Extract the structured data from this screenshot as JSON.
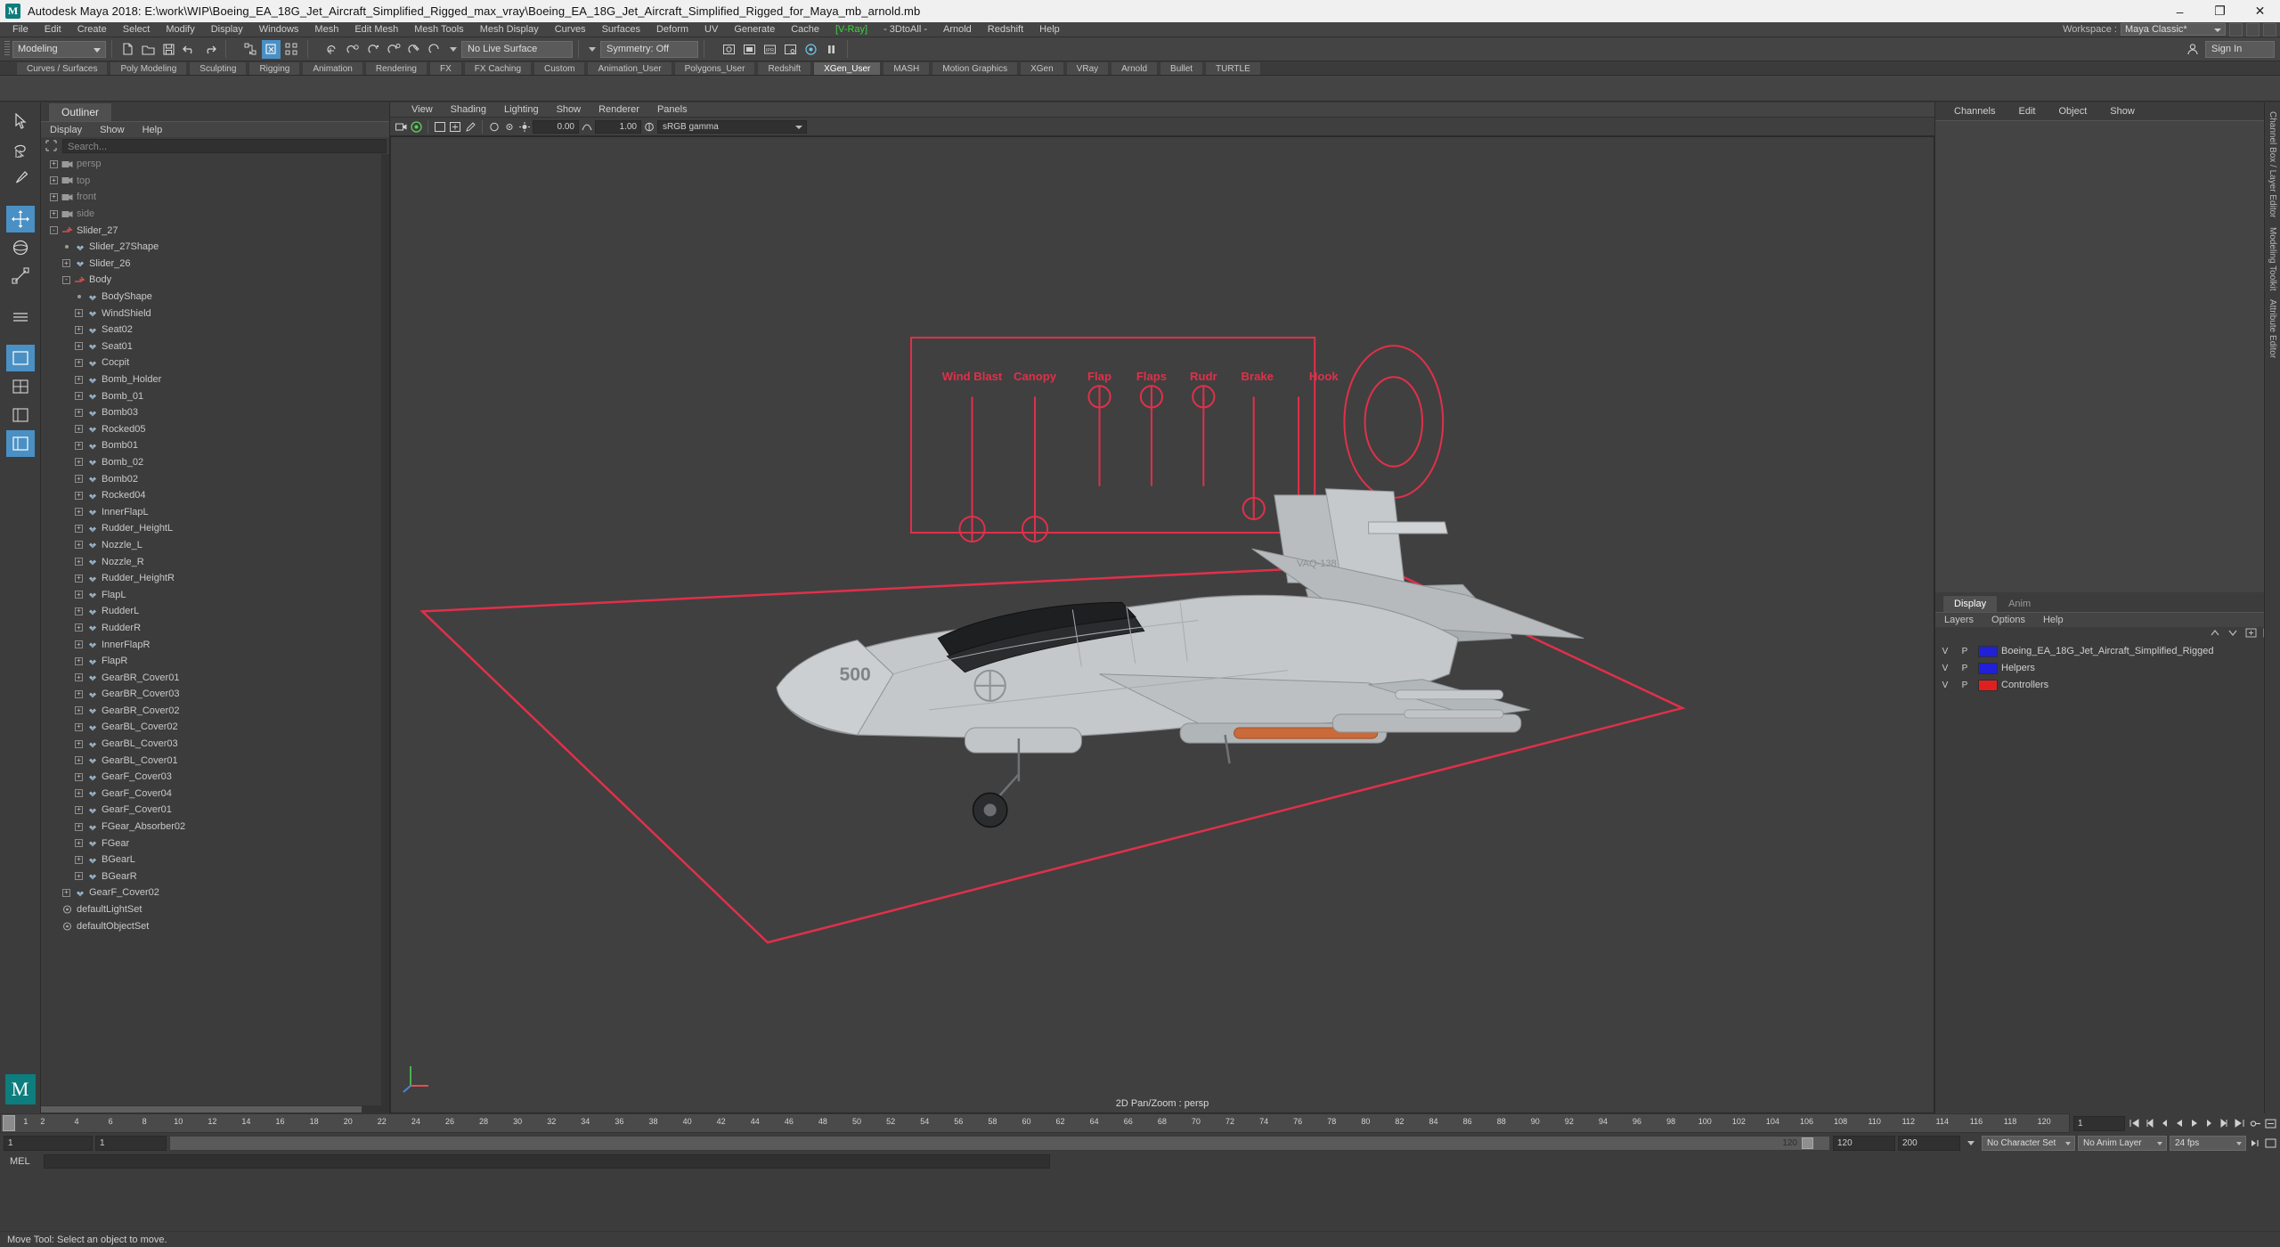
{
  "titlebar": {
    "app_icon": "maya-logo-icon",
    "title": "Autodesk Maya 2018: E:\\work\\WIP\\Boeing_EA_18G_Jet_Aircraft_Simplified_Rigged_max_vray\\Boeing_EA_18G_Jet_Aircraft_Simplified_Rigged_for_Maya_mb_arnold.mb",
    "minimize": "–",
    "maximize": "❐",
    "close": "✕"
  },
  "menubar": {
    "items": [
      {
        "label": "File"
      },
      {
        "label": "Edit"
      },
      {
        "label": "Create"
      },
      {
        "label": "Select"
      },
      {
        "label": "Modify"
      },
      {
        "label": "Display"
      },
      {
        "label": "Windows"
      },
      {
        "label": "Mesh"
      },
      {
        "label": "Edit Mesh"
      },
      {
        "label": "Mesh Tools"
      },
      {
        "label": "Mesh Display"
      },
      {
        "label": "Curves"
      },
      {
        "label": "Surfaces"
      },
      {
        "label": "Deform"
      },
      {
        "label": "UV"
      },
      {
        "label": "Generate"
      },
      {
        "label": "Cache"
      },
      {
        "label": "[V-Ray]",
        "highlight": true
      },
      {
        "label": "- 3DtoAll -"
      },
      {
        "label": "Arnold"
      },
      {
        "label": "Redshift"
      },
      {
        "label": "Help"
      }
    ],
    "workspace_label": "Workspace :",
    "workspace_value": "Maya Classic*"
  },
  "statusline": {
    "mode": "Modeling",
    "live_surface": "No Live Surface",
    "symmetry": "Symmetry: Off",
    "no_live_surface_placeholder": "No Live Surface"
  },
  "shelf": {
    "tabs": [
      {
        "label": "Curves / Surfaces"
      },
      {
        "label": "Poly Modeling"
      },
      {
        "label": "Sculpting"
      },
      {
        "label": "Rigging"
      },
      {
        "label": "Animation"
      },
      {
        "label": "Rendering"
      },
      {
        "label": "FX"
      },
      {
        "label": "FX Caching"
      },
      {
        "label": "Custom"
      },
      {
        "label": "Animation_User"
      },
      {
        "label": "Polygons_User"
      },
      {
        "label": "Redshift"
      },
      {
        "label": "XGen_User",
        "active": true
      },
      {
        "label": "MASH"
      },
      {
        "label": "Motion Graphics"
      },
      {
        "label": "XGen"
      },
      {
        "label": "VRay"
      },
      {
        "label": "Arnold"
      },
      {
        "label": "Bullet"
      },
      {
        "label": "TURTLE"
      }
    ]
  },
  "sign_in": "Sign In",
  "outliner": {
    "tab": "Outliner",
    "menus": [
      "Display",
      "Show",
      "Help"
    ],
    "search_placeholder": "Search...",
    "items": [
      {
        "label": "persp",
        "indent": 0,
        "exp": "+",
        "icon": "camera-icon",
        "dim": true
      },
      {
        "label": "top",
        "indent": 0,
        "exp": "+",
        "icon": "camera-icon",
        "dim": true
      },
      {
        "label": "front",
        "indent": 0,
        "exp": "+",
        "icon": "camera-icon",
        "dim": true
      },
      {
        "label": "side",
        "indent": 0,
        "exp": "+",
        "icon": "camera-icon",
        "dim": true
      },
      {
        "label": "Slider_27",
        "indent": 0,
        "exp": "-",
        "icon": "transform-icon"
      },
      {
        "label": "Slider_27Shape",
        "indent": 1,
        "exp": "dot",
        "icon": "mesh-icon"
      },
      {
        "label": "Slider_26",
        "indent": 1,
        "exp": "+",
        "icon": "mesh-icon"
      },
      {
        "label": "Body",
        "indent": 1,
        "exp": "-",
        "icon": "transform-icon"
      },
      {
        "label": "BodyShape",
        "indent": 2,
        "exp": "dot",
        "icon": "mesh-icon"
      },
      {
        "label": "WindShield",
        "indent": 2,
        "exp": "+",
        "icon": "mesh-icon"
      },
      {
        "label": "Seat02",
        "indent": 2,
        "exp": "+",
        "icon": "mesh-icon"
      },
      {
        "label": "Seat01",
        "indent": 2,
        "exp": "+",
        "icon": "mesh-icon"
      },
      {
        "label": "Cocpit",
        "indent": 2,
        "exp": "+",
        "icon": "mesh-icon"
      },
      {
        "label": "Bomb_Holder",
        "indent": 2,
        "exp": "+",
        "icon": "mesh-icon"
      },
      {
        "label": "Bomb_01",
        "indent": 2,
        "exp": "+",
        "icon": "mesh-icon"
      },
      {
        "label": "Bomb03",
        "indent": 2,
        "exp": "+",
        "icon": "mesh-icon"
      },
      {
        "label": "Rocked05",
        "indent": 2,
        "exp": "+",
        "icon": "mesh-icon"
      },
      {
        "label": "Bomb01",
        "indent": 2,
        "exp": "+",
        "icon": "mesh-icon"
      },
      {
        "label": "Bomb_02",
        "indent": 2,
        "exp": "+",
        "icon": "mesh-icon"
      },
      {
        "label": "Bomb02",
        "indent": 2,
        "exp": "+",
        "icon": "mesh-icon"
      },
      {
        "label": "Rocked04",
        "indent": 2,
        "exp": "+",
        "icon": "mesh-icon"
      },
      {
        "label": "InnerFlapL",
        "indent": 2,
        "exp": "+",
        "icon": "mesh-icon"
      },
      {
        "label": "Rudder_HeightL",
        "indent": 2,
        "exp": "+",
        "icon": "mesh-icon"
      },
      {
        "label": "Nozzle_L",
        "indent": 2,
        "exp": "+",
        "icon": "mesh-icon"
      },
      {
        "label": "Nozzle_R",
        "indent": 2,
        "exp": "+",
        "icon": "mesh-icon"
      },
      {
        "label": "Rudder_HeightR",
        "indent": 2,
        "exp": "+",
        "icon": "mesh-icon"
      },
      {
        "label": "FlapL",
        "indent": 2,
        "exp": "+",
        "icon": "mesh-icon"
      },
      {
        "label": "RudderL",
        "indent": 2,
        "exp": "+",
        "icon": "mesh-icon"
      },
      {
        "label": "RudderR",
        "indent": 2,
        "exp": "+",
        "icon": "mesh-icon"
      },
      {
        "label": "InnerFlapR",
        "indent": 2,
        "exp": "+",
        "icon": "mesh-icon"
      },
      {
        "label": "FlapR",
        "indent": 2,
        "exp": "+",
        "icon": "mesh-icon"
      },
      {
        "label": "GearBR_Cover01",
        "indent": 2,
        "exp": "+",
        "icon": "mesh-icon"
      },
      {
        "label": "GearBR_Cover03",
        "indent": 2,
        "exp": "+",
        "icon": "mesh-icon"
      },
      {
        "label": "GearBR_Cover02",
        "indent": 2,
        "exp": "+",
        "icon": "mesh-icon"
      },
      {
        "label": "GearBL_Cover02",
        "indent": 2,
        "exp": "+",
        "icon": "mesh-icon"
      },
      {
        "label": "GearBL_Cover03",
        "indent": 2,
        "exp": "+",
        "icon": "mesh-icon"
      },
      {
        "label": "GearBL_Cover01",
        "indent": 2,
        "exp": "+",
        "icon": "mesh-icon"
      },
      {
        "label": "GearF_Cover03",
        "indent": 2,
        "exp": "+",
        "icon": "mesh-icon"
      },
      {
        "label": "GearF_Cover04",
        "indent": 2,
        "exp": "+",
        "icon": "mesh-icon"
      },
      {
        "label": "GearF_Cover01",
        "indent": 2,
        "exp": "+",
        "icon": "mesh-icon"
      },
      {
        "label": "FGear_Absorber02",
        "indent": 2,
        "exp": "+",
        "icon": "mesh-icon"
      },
      {
        "label": "FGear",
        "indent": 2,
        "exp": "+",
        "icon": "mesh-icon"
      },
      {
        "label": "BGearL",
        "indent": 2,
        "exp": "+",
        "icon": "mesh-icon"
      },
      {
        "label": "BGearR",
        "indent": 2,
        "exp": "+",
        "icon": "mesh-icon"
      },
      {
        "label": "GearF_Cover02",
        "indent": 1,
        "exp": "+",
        "icon": "mesh-icon"
      },
      {
        "label": "defaultLightSet",
        "indent": 0,
        "exp": "none",
        "icon": "set-icon"
      },
      {
        "label": "defaultObjectSet",
        "indent": 0,
        "exp": "none",
        "icon": "set-icon"
      }
    ]
  },
  "viewport": {
    "menus": [
      "View",
      "Shading",
      "Lighting",
      "Show",
      "Renderer",
      "Panels"
    ],
    "exposure": "0.00",
    "gamma_value": "1.00",
    "color_management": "sRGB gamma",
    "label": "2D Pan/Zoom : persp",
    "plane_number": "500",
    "tail_marking": "VAQ-138",
    "hud_title": "Wind Blast",
    "hud_labels": [
      "Wind Blast",
      "Canopy",
      "Flap",
      "Flaps",
      "Rudr",
      "Brake",
      "Hook"
    ]
  },
  "channelbox": {
    "tabs": [
      "Channels",
      "Edit",
      "Object",
      "Show"
    ]
  },
  "layereditor": {
    "tabs": [
      {
        "label": "Display",
        "active": true
      },
      {
        "label": "Anim",
        "active": false
      }
    ],
    "menus": [
      "Layers",
      "Options",
      "Help"
    ],
    "columns": [
      "V",
      "P"
    ],
    "layers": [
      {
        "v": "V",
        "p": "P",
        "color": "#2020d8",
        "name": "Boeing_EA_18G_Jet_Aircraft_Simplified_Rigged"
      },
      {
        "v": "V",
        "p": "P",
        "color": "#2020d8",
        "name": "Helpers"
      },
      {
        "v": "V",
        "p": "P",
        "color": "#e02020",
        "name": "Controllers"
      }
    ]
  },
  "rightdock": {
    "labels": [
      "Channel Box / Layer Editor",
      "Modeling Toolkit",
      "Attribute Editor"
    ]
  },
  "timeline": {
    "start_tick": 1,
    "end_tick": 120,
    "ticks": [
      1,
      2,
      4,
      6,
      8,
      10,
      12,
      14,
      16,
      18,
      20,
      22,
      24,
      26,
      28,
      30,
      32,
      34,
      36,
      38,
      40,
      42,
      44,
      46,
      48,
      50,
      52,
      54,
      56,
      58,
      60,
      62,
      64,
      66,
      68,
      70,
      72,
      74,
      76,
      78,
      80,
      82,
      84,
      86,
      88,
      90,
      92,
      94,
      96,
      98,
      100,
      102,
      104,
      106,
      108,
      110,
      112,
      114,
      116,
      118,
      120
    ],
    "current_frame": "1",
    "frame_field": "1"
  },
  "range": {
    "range_start": "1",
    "anim_start": "1",
    "range_end_marker": "120",
    "playback_end": "120",
    "anim_end": "200",
    "character_set": "No Character Set",
    "anim_layer": "No Anim Layer",
    "fps": "24 fps"
  },
  "commandline": {
    "label": "MEL",
    "value": ""
  },
  "statusbar": {
    "help": "Move Tool: Select an object to move."
  },
  "colors": {
    "accent_blue": "#4a90c4",
    "selection_red": "#e0304a",
    "green_menu": "#3bd43b",
    "panel_bg": "#3c3c3c",
    "viewport_bg": "#404040"
  }
}
